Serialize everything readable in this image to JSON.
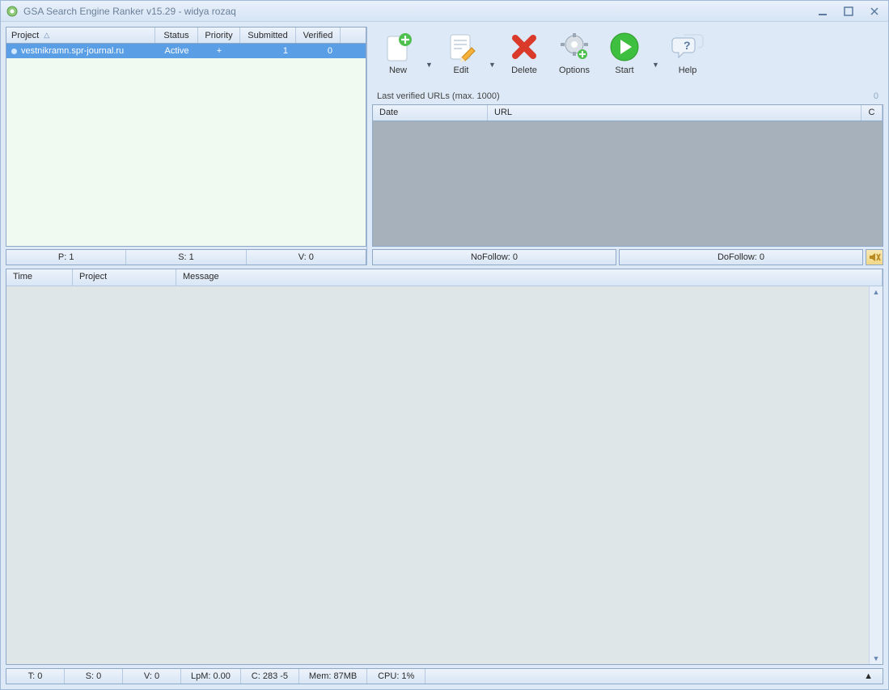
{
  "window": {
    "title": "GSA Search Engine Ranker v15.29 - widya rozaq"
  },
  "project_table": {
    "headers": {
      "project": "Project",
      "status": "Status",
      "priority": "Priority",
      "submitted": "Submitted",
      "verified": "Verified"
    },
    "rows": [
      {
        "name": "vestnikramn.spr-journal.ru",
        "status": "Active",
        "priority": "+",
        "submitted": "1",
        "verified": "0"
      }
    ],
    "summary": {
      "p": "P: 1",
      "s": "S: 1",
      "v": "V: 0"
    }
  },
  "toolbar": {
    "new": "New",
    "edit": "Edit",
    "delete": "Delete",
    "options": "Options",
    "start": "Start",
    "help": "Help"
  },
  "verified": {
    "label": "Last verified URLs (max. 1000)",
    "count": "0",
    "headers": {
      "date": "Date",
      "url": "URL",
      "c": "C"
    }
  },
  "follow": {
    "nofollow": "NoFollow:  0",
    "dofollow": "DoFollow:  0"
  },
  "log": {
    "headers": {
      "time": "Time",
      "project": "Project",
      "message": "Message"
    }
  },
  "status": {
    "t": "T: 0",
    "s": "S: 0",
    "v": "V: 0",
    "lpm": "LpM: 0.00",
    "c": "C: 283 -5",
    "mem": "Mem: 87MB",
    "cpu": "CPU: 1%"
  }
}
